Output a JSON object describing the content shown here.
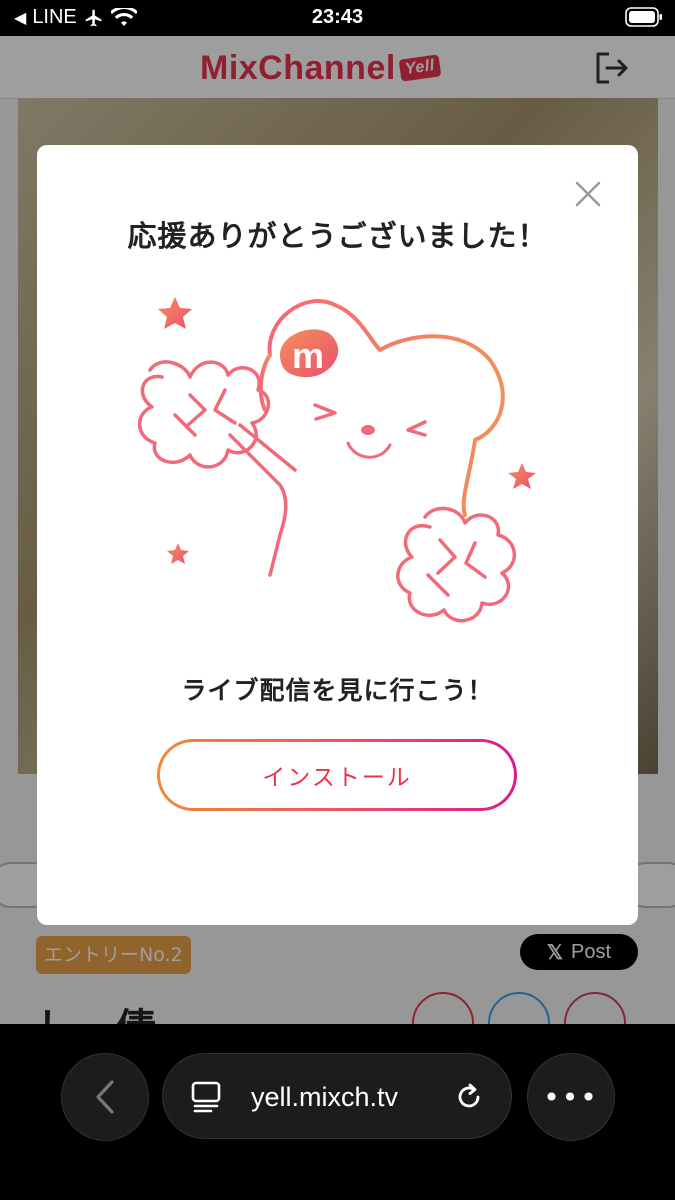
{
  "status_bar": {
    "back_app": "LINE",
    "time": "23:43"
  },
  "header": {
    "logo_text": "MixChannel",
    "logo_tag": "Yell"
  },
  "background_page": {
    "entry_badge": "エントリーNo.2",
    "post_button": "Post",
    "name_partial": "しー倩"
  },
  "modal": {
    "title": "応援ありがとうございました！",
    "subtitle": "ライブ配信を見に行こう！",
    "install_label": "インストール",
    "mascot_badge": "m"
  },
  "browser": {
    "url": "yell.mixch.tv",
    "more_label": "•••"
  },
  "colors": {
    "accent": "#e8344d",
    "gradient_start": "#f08a3a",
    "gradient_end": "#e0198a"
  }
}
